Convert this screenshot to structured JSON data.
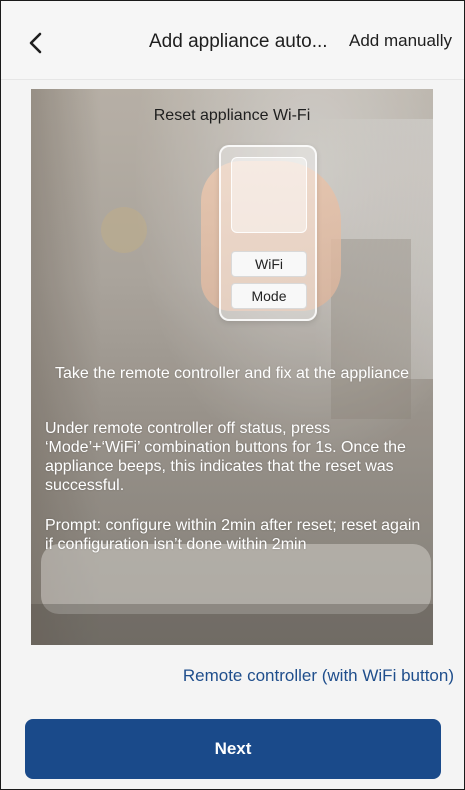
{
  "header": {
    "back_icon": "chevron-left-icon",
    "title": "Add appliance auto...",
    "add_manually": "Add manually"
  },
  "panel": {
    "title": "Reset appliance Wi-Fi",
    "remote_buttons": [
      "WiFi",
      "Mode"
    ],
    "instruction": "Take the remote controller and fix at the appliance",
    "description": "Under remote controller off status, press ‘Mode’+‘WiFi’ combination buttons for 1s. Once the appliance beeps, this indicates that the reset was successful.",
    "prompt": "Prompt: configure within 2min after reset; reset again if configuration isn’t done within 2min"
  },
  "remote_type_link": "Remote controller (with WiFi button)",
  "next_button": "Next",
  "colors": {
    "primary": "#1a4a8a",
    "link": "#1f4e8c"
  }
}
